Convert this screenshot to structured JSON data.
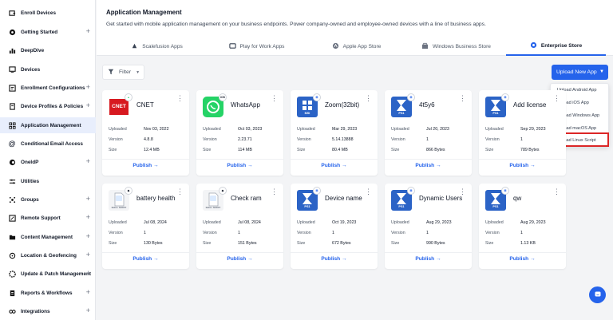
{
  "sidebar": {
    "items": [
      {
        "label": "Enroll Devices",
        "icon": "enroll-icon",
        "plus": ""
      },
      {
        "label": "Getting Started",
        "icon": "rocket-icon",
        "plus": "+"
      },
      {
        "label": "DeepDive",
        "icon": "chart-icon",
        "plus": ""
      },
      {
        "label": "Devices",
        "icon": "devices-icon",
        "plus": ""
      },
      {
        "label": "Enrollment Configurations",
        "icon": "config-icon",
        "plus": "+"
      },
      {
        "label": "Device Profiles & Policies",
        "icon": "profile-icon",
        "plus": "+"
      },
      {
        "label": "Application Management",
        "icon": "grid-icon",
        "plus": ""
      },
      {
        "label": "Conditional Email Access",
        "icon": "at-icon",
        "plus": ""
      },
      {
        "label": "OneIdP",
        "icon": "oneidp-icon",
        "plus": "+"
      },
      {
        "label": "Utilities",
        "icon": "sliders-icon",
        "plus": ""
      },
      {
        "label": "Groups",
        "icon": "groups-icon",
        "plus": "+"
      },
      {
        "label": "Remote Support",
        "icon": "remote-icon",
        "plus": "+"
      },
      {
        "label": "Content Management",
        "icon": "folder-icon",
        "plus": "+"
      },
      {
        "label": "Location & Geofencing",
        "icon": "location-icon",
        "plus": "+"
      },
      {
        "label": "Update & Patch Management",
        "icon": "update-icon",
        "plus": "+"
      },
      {
        "label": "Reports & Workflows",
        "icon": "reports-icon",
        "plus": "+"
      },
      {
        "label": "Integrations",
        "icon": "integrations-icon",
        "plus": "+"
      }
    ]
  },
  "header": {
    "title": "Application Management",
    "subtitle": "Get started with mobile application management on your business endpoints. Power company-owned and employee-owned devices with a line of business apps."
  },
  "tabs": [
    {
      "label": "Scalefusion Apps",
      "icon": "scalefusion-icon"
    },
    {
      "label": "Play for Work Apps",
      "icon": "play-work-icon"
    },
    {
      "label": "Apple App Store",
      "icon": "apple-store-icon"
    },
    {
      "label": "Windows Business Store",
      "icon": "windows-store-icon"
    },
    {
      "label": "Enterprise Store",
      "icon": "enterprise-store-icon"
    }
  ],
  "filter": {
    "label": "Filter"
  },
  "upload": {
    "label": "Upload New App",
    "options": [
      "Upload Android App",
      "Upload iOS App",
      "Upload Windows App",
      "Upload macOS App",
      "Upload Linux Script"
    ]
  },
  "meta_labels": {
    "uploaded": "Uploaded",
    "version": "Version",
    "size": "Size"
  },
  "publish_label": "Publish →",
  "menu_glyph": "⋮",
  "apps": [
    {
      "name": "CNET",
      "uploaded": "Nov 03, 2022",
      "version": "4.8.8",
      "size": "12.4 MB",
      "logo": "cnet",
      "logo_text": "CNET",
      "badge": "android-icon"
    },
    {
      "name": "WhatsApp",
      "uploaded": "Oct 03, 2023",
      "version": "2.23.71",
      "size": "114 MB",
      "logo": "whatsapp",
      "logo_text": "",
      "badge": "iOS"
    },
    {
      "name": "Zoom(32bit)",
      "uploaded": "Mar 29, 2023",
      "version": "5.14.13888",
      "size": "80.4 MB",
      "logo": "msi",
      "logo_text": "MSI",
      "badge": "windows-icon"
    },
    {
      "name": "4t5y6",
      "uploaded": "Jul 20, 2023",
      "version": "1",
      "size": "866 Bytes",
      "logo": "ps1",
      "logo_text": "PS1",
      "badge": "windows-icon"
    },
    {
      "name": "Add license",
      "uploaded": "Sep 29, 2023",
      "version": "1",
      "size": "789 Bytes",
      "logo": "ps1",
      "logo_text": "PS1",
      "badge": "windows-icon"
    },
    {
      "name": "battery health",
      "uploaded": "Jul 08, 2024",
      "version": "1",
      "size": "130 Bytes",
      "logo": "shell",
      "logo_text": "SHELL SCRIPT",
      "badge": "linux-icon"
    },
    {
      "name": "Check ram",
      "uploaded": "Jul 08, 2024",
      "version": "1",
      "size": "151 Bytes",
      "logo": "shell",
      "logo_text": "SHELL SCRIPT",
      "badge": "linux-icon"
    },
    {
      "name": "Device name",
      "uploaded": "Oct 19, 2023",
      "version": "1",
      "size": "672 Bytes",
      "logo": "ps1",
      "logo_text": "PS1",
      "badge": "windows-icon"
    },
    {
      "name": "Dynamic Users",
      "uploaded": "Aug 29, 2023",
      "version": "1",
      "size": "990 Bytes",
      "logo": "ps1",
      "logo_text": "PS1",
      "badge": "windows-icon"
    },
    {
      "name": "qw",
      "uploaded": "Aug 29, 2023",
      "version": "1",
      "size": "1.13 KB",
      "logo": "ps1",
      "logo_text": "PS1",
      "badge": "windows-icon"
    }
  ],
  "colors": {
    "accent": "#2563eb",
    "highlight": "#dc2626",
    "active_bg": "#e8eefc"
  }
}
